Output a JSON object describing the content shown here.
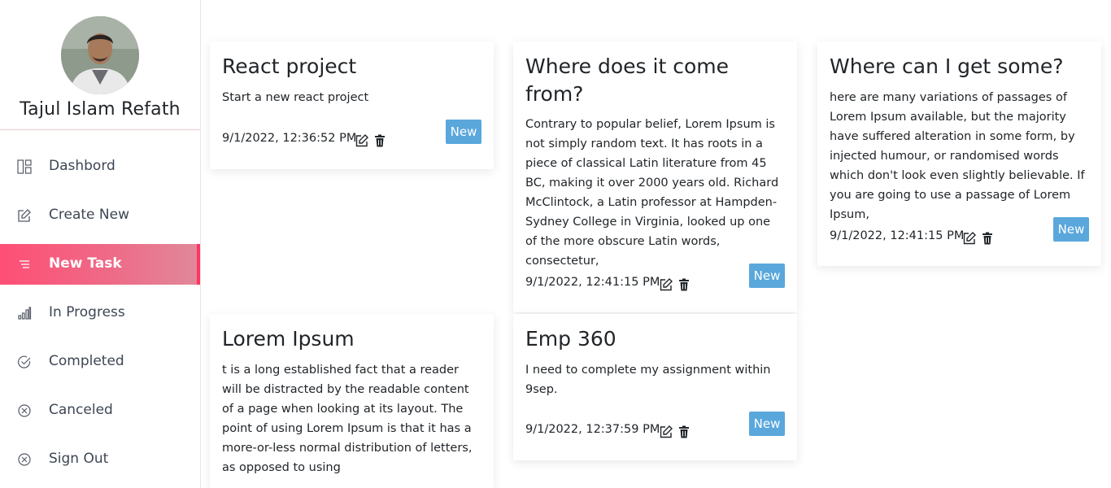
{
  "profile": {
    "name": "Tajul Islam Refath"
  },
  "sidebar": {
    "items": [
      {
        "label": "Dashbord",
        "icon": "dashboard-icon"
      },
      {
        "label": "Create New",
        "icon": "edit-icon"
      },
      {
        "label": "New Task",
        "icon": "list-icon",
        "active": true
      },
      {
        "label": "In Progress",
        "icon": "bar-chart-icon"
      },
      {
        "label": "Completed",
        "icon": "check-circle-icon"
      },
      {
        "label": "Canceled",
        "icon": "x-circle-icon"
      },
      {
        "label": "Sign Out",
        "icon": "x-circle-icon"
      }
    ]
  },
  "colors": {
    "active_gradient_start": "#ff4f75",
    "badge": "#5aa7dc"
  },
  "cards": [
    {
      "title": "React project",
      "description": "Start a new react project",
      "date": "9/1/2022, 12:36:52 PM",
      "status": "New"
    },
    {
      "title": "Where does it come from?",
      "description": "Contrary to popular belief, Lorem Ipsum is not simply random text. It has roots in a piece of classical Latin literature from 45 BC, making it over 2000 years old. Richard McClintock, a Latin professor at Hampden-Sydney College in Virginia, looked up one of the more obscure Latin words, consectetur,",
      "date": "9/1/2022, 12:41:15 PM",
      "status": "New"
    },
    {
      "title": "Where can I get some?",
      "description": "here are many variations of passages of Lorem Ipsum available, but the majority have suffered alteration in some form, by injected humour, or randomised words which don't look even slightly believable. If you are going to use a passage of Lorem Ipsum,",
      "date": "9/1/2022, 12:41:15 PM",
      "status": "New"
    },
    {
      "title": "Lorem Ipsum",
      "description": "t is a long established fact that a reader will be distracted by the readable content of a page when looking at its layout. The point of using Lorem Ipsum is that it has a more-or-less normal distribution of letters, as opposed to using",
      "date": "",
      "status": ""
    },
    {
      "title": "Emp 360",
      "description": "I need to complete my assignment within 9sep.",
      "date": "9/1/2022, 12:37:59 PM",
      "status": "New"
    }
  ]
}
